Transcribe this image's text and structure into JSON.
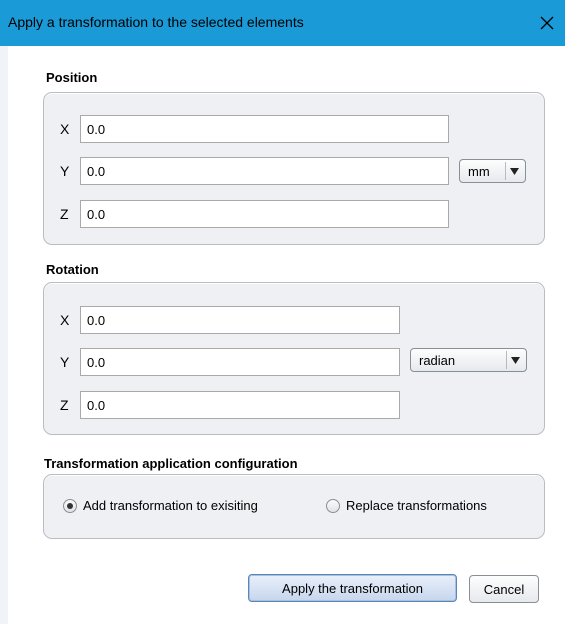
{
  "dialog": {
    "title": "Apply a transformation to the selected elements",
    "titlebar_color": "#1a9bd8"
  },
  "position": {
    "title": "Position",
    "x_label": "X",
    "x_value": "0.0",
    "y_label": "Y",
    "y_value": "0.0",
    "z_label": "Z",
    "z_value": "0.0",
    "unit": "mm"
  },
  "rotation": {
    "title": "Rotation",
    "x_label": "X",
    "x_value": "0.0",
    "y_label": "Y",
    "y_value": "0.0",
    "z_label": "Z",
    "z_value": "0.0",
    "unit": "radian"
  },
  "config": {
    "title": "Transformation application configuration",
    "option_add": "Add transformation to exisiting",
    "option_replace": "Replace transformations",
    "selected": "add"
  },
  "buttons": {
    "apply": "Apply the transformation",
    "cancel": "Cancel"
  },
  "icons": {
    "close": "close-icon",
    "dropdown": "triangle-down-icon"
  }
}
